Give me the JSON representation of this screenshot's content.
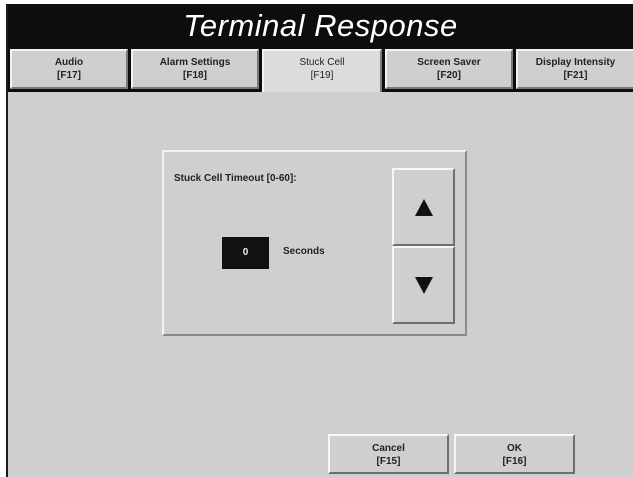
{
  "window": {
    "title": "Terminal Response"
  },
  "tabs": [
    {
      "name": "Audio",
      "key": "[F17]"
    },
    {
      "name": "Alarm Settings",
      "key": "[F18]"
    },
    {
      "name": "Stuck Cell",
      "key": "[F19]"
    },
    {
      "name": "Screen Saver",
      "key": "[F20]"
    },
    {
      "name": "Display Intensity",
      "key": "[F21]"
    }
  ],
  "active_tab": "Stuck Cell",
  "panel": {
    "label": "Stuck Cell Timeout [0-60]:",
    "value": "0",
    "unit": "Seconds",
    "up_icon": "up-arrow-icon",
    "down_icon": "down-arrow-icon"
  },
  "buttons": {
    "cancel": {
      "name": "Cancel",
      "key": "[F15]"
    },
    "ok": {
      "name": "OK",
      "key": "[F16]"
    }
  },
  "colors": {
    "title_background": "#0d0d0d",
    "title_text": "#ffffff",
    "body_background": "#cfcfcf",
    "value_background": "#111111"
  }
}
